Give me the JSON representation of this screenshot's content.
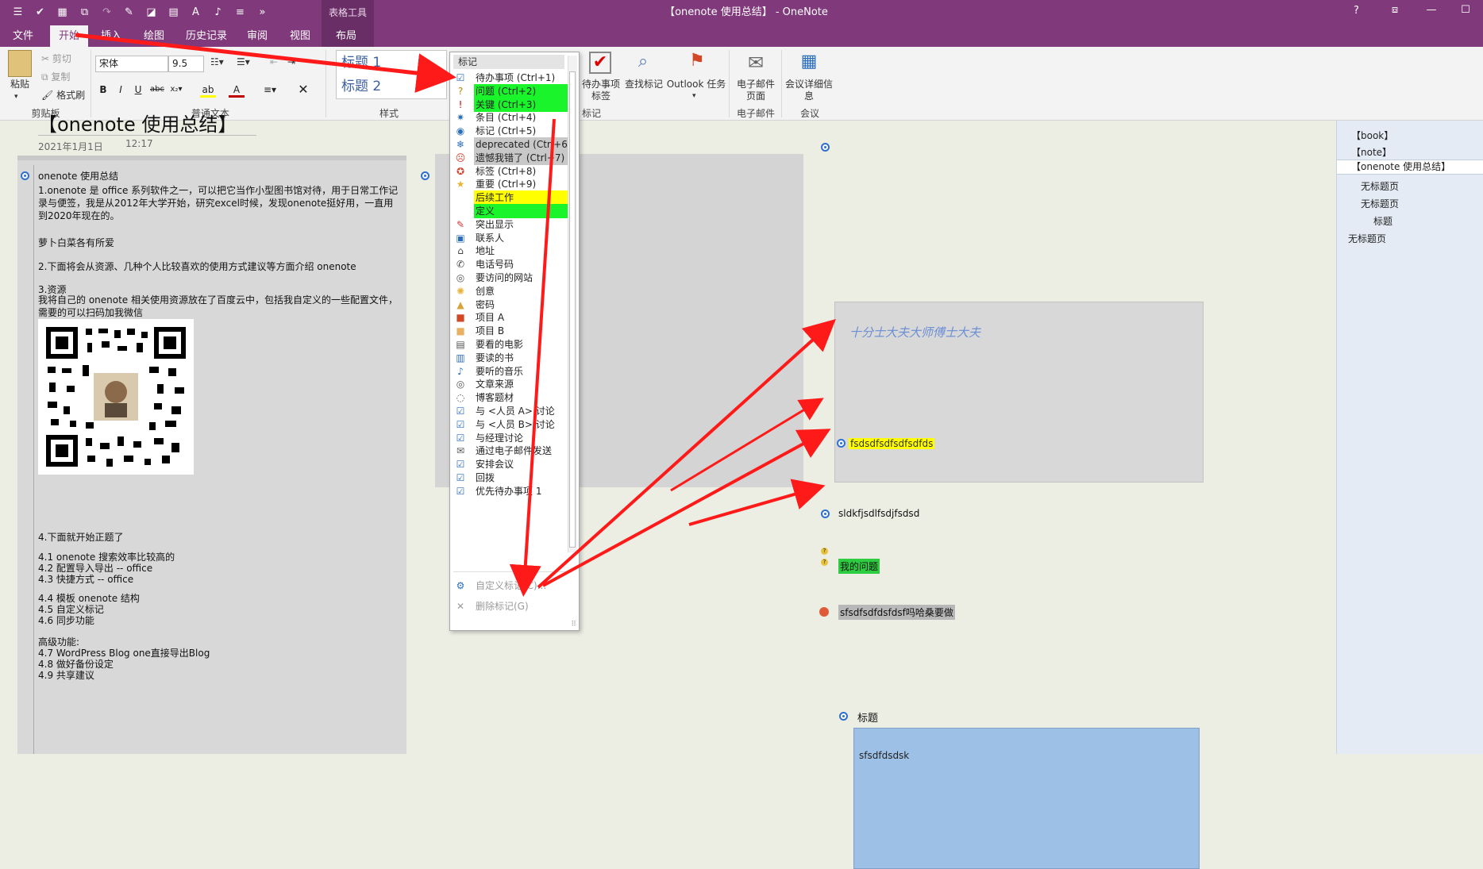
{
  "titlebar": {
    "title": "【onenote 使用总结】 - OneNote",
    "context_tab": "表格工具",
    "help": "?",
    "color": "#80397b"
  },
  "tabs": [
    "文件",
    "开始",
    "插入",
    "绘图",
    "历史记录",
    "审阅",
    "视图",
    "布局"
  ],
  "active_tab": "开始",
  "ribbon": {
    "clipboard": {
      "paste": "粘贴",
      "cut": "剪切",
      "copy": "复制",
      "format_painter": "格式刷",
      "group": "剪贴板"
    },
    "font": {
      "name": "宋体",
      "size": "9.5",
      "group": "普通文本"
    },
    "styles": {
      "h1": "标题 1",
      "h2": "标题 2",
      "group": "样式"
    },
    "tags": {
      "todo_tag": "待办事项标签",
      "find_tags": "查找标记",
      "outlook_tasks": "Outlook 任务",
      "group": "标记"
    },
    "email": {
      "email_page": "电子邮件页面",
      "group": "电子邮件"
    },
    "meetings": {
      "meeting_details": "会议详细信息",
      "group": "会议"
    }
  },
  "page": {
    "title": "【onenote 使用总结】",
    "date": "2021年1月1日",
    "time": "12:17"
  },
  "note1": {
    "heading": "onenote 使用总结",
    "p1": "1.onenote 是 office 系列软件之一，可以把它当作小型图书馆对待，用于日常工作记录与便签，我是从2012年大学开始，研究excel时候，发现onenote挺好用，一直用到2020年现在的。",
    "p2": "萝卜白菜各有所爱",
    "p3": "2.下面将会从资源、几种个人比较喜欢的使用方式建议等方面介绍 onenote",
    "p4": "3.资源",
    "p5": "我将自己的 onenote 相关使用资源放在了百度云中，包括我自定义的一些配置文件，需要的可以扫码加我微信",
    "p6": "4.下面就开始正题了",
    "l1": "4.1 onenote 搜索效率比较高的",
    "l2": "4.2 配置导入导出 -- office",
    "l3": "4.3 快捷方式 -- office",
    "l4": "4.4 模板 onenote 结构",
    "l5": "4.5 自定义标记",
    "l6": "4.6  同步功能",
    "adv": "高级功能:",
    "l7": "4.7 WordPress Blog one直接导出Blog",
    "l8": "4.8 做好备份设定",
    "l9": "4.9 共享建议"
  },
  "note3": {
    "italic": "十分士大夫大师傅士大夫",
    "yellow": "fsdsdfsdfsdfsdfds"
  },
  "right_items": {
    "plain": "sldkfjsdlfsdjfsdsd",
    "question": "我的问题",
    "bad": "sfsdfsdfdsfdsf吗哈桑要做"
  },
  "note4": {
    "title": "标题",
    "text": "sfsdfdsdsk"
  },
  "sidebar": {
    "items": [
      "【book】",
      "【note】",
      "【onenote 使用总结】",
      "无标题页",
      "无标题页",
      "标题",
      "无标题页"
    ]
  },
  "dropdown": {
    "header": "标记",
    "items": [
      {
        "label": "待办事项 (Ctrl+1)",
        "icon": "checkbox-icon"
      },
      {
        "label": "问题 (Ctrl+2)",
        "icon": "question-icon"
      },
      {
        "label": "关键 (Ctrl+3)",
        "icon": "exclamation-icon"
      },
      {
        "label": "条目 (Ctrl+4)",
        "icon": "star-burst-icon"
      },
      {
        "label": "标记 (Ctrl+5)",
        "icon": "target-icon"
      },
      {
        "label": "deprecated (Ctrl+6)",
        "icon": "snowflake-icon"
      },
      {
        "label": "遗憾我错了 (Ctrl+7)",
        "icon": "sad-face-icon"
      },
      {
        "label": "标签 (Ctrl+8)",
        "icon": "ribbon-icon"
      },
      {
        "label": "重要 (Ctrl+9)",
        "icon": "star-icon"
      },
      {
        "label": "后续工作",
        "icon": ""
      },
      {
        "label": "定义",
        "icon": ""
      },
      {
        "label": "突出显示",
        "icon": "pen-icon"
      },
      {
        "label": "联系人",
        "icon": "contact-card-icon"
      },
      {
        "label": "地址",
        "icon": "house-icon"
      },
      {
        "label": "电话号码",
        "icon": "phone-icon"
      },
      {
        "label": "要访问的网站",
        "icon": "globe-icon"
      },
      {
        "label": "创意",
        "icon": "lightbulb-icon"
      },
      {
        "label": "密码",
        "icon": "lock-icon"
      },
      {
        "label": "项目 A",
        "icon": "square-red-icon"
      },
      {
        "label": "项目 B",
        "icon": "square-orange-icon"
      },
      {
        "label": "要看的电影",
        "icon": "film-icon"
      },
      {
        "label": "要读的书",
        "icon": "book-icon"
      },
      {
        "label": "要听的音乐",
        "icon": "music-note-icon"
      },
      {
        "label": "文章来源",
        "icon": "globe-icon"
      },
      {
        "label": "博客题材",
        "icon": "speech-bubble-icon"
      },
      {
        "label": "与 <人员 A> 讨论",
        "icon": "checkbox-person-icon"
      },
      {
        "label": "与 <人员 B> 讨论",
        "icon": "checkbox-person-icon"
      },
      {
        "label": "与经理讨论",
        "icon": "checkbox-person-icon"
      },
      {
        "label": "通过电子邮件发送",
        "icon": "email-icon"
      },
      {
        "label": "安排会议",
        "icon": "calendar-check-icon"
      },
      {
        "label": "回拨",
        "icon": "phone-check-icon"
      },
      {
        "label": "优先待办事项 1",
        "icon": "priority-check-icon"
      }
    ],
    "customize": "自定义标记(C)...",
    "remove": "删除标记(G)"
  },
  "colors": {
    "accent": "#80397b",
    "green": "#19f52a",
    "yellow": "#ffff00",
    "arrow": "#ff1a1a"
  }
}
